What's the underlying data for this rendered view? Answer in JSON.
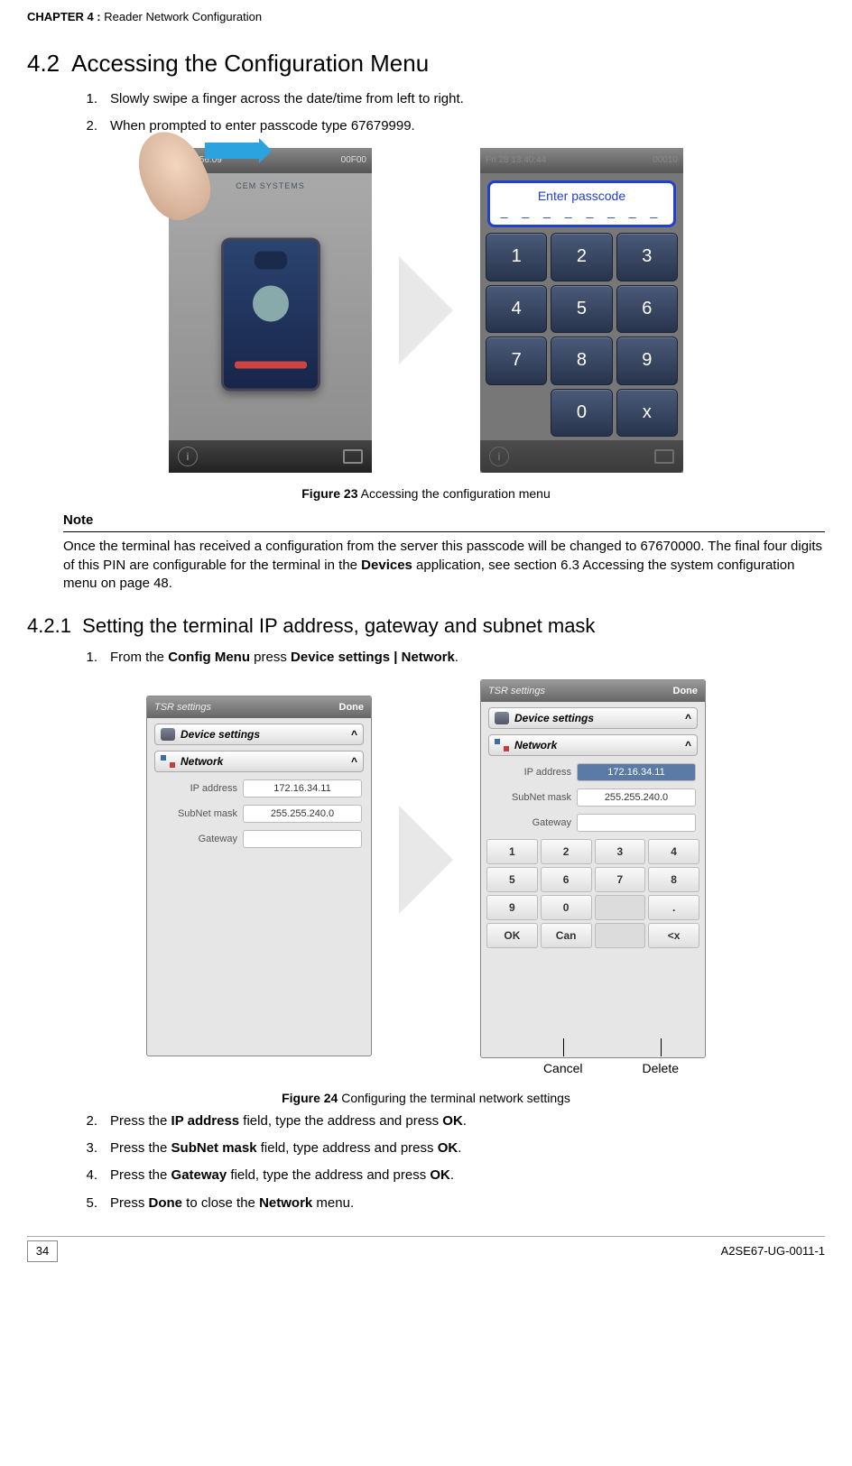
{
  "header": {
    "chapter": "CHAPTER 4 : ",
    "title": "Reader Network Configuration"
  },
  "section42": {
    "num": "4.2",
    "title": "Accessing the Configuration Menu",
    "steps": [
      {
        "n": "1.",
        "t": "Slowly swipe a finger across the date/time from left to right."
      },
      {
        "n": "2.",
        "t": "When prompted to enter passcode type 67679999."
      }
    ]
  },
  "fig23": {
    "label": "Figure 23",
    "caption": " Accessing the configuration menu",
    "left_status_time": "18  10:56:09",
    "left_status_code": "00F00",
    "left_brand": "CEM SYSTEMS",
    "right_status_time": "Fri 28  13:40:44",
    "right_status_code": "00010",
    "passcode_title": "Enter passcode",
    "passcode_dashes": "_ _ _ _ _ _ _ _",
    "keys": [
      "1",
      "2",
      "3",
      "4",
      "5",
      "6",
      "7",
      "8",
      "9",
      "",
      "0",
      "x"
    ]
  },
  "note": {
    "heading": "Note",
    "body_pre": "Once the terminal has received a configuration from the server this passcode will be changed to 67670000. The final four digits of this PIN are configurable for the terminal in the ",
    "body_bold": "Devices",
    "body_post": " application, see section 6.3   Accessing the system configuration menu on page 48."
  },
  "section421": {
    "num": "4.2.1",
    "title": "Setting the terminal IP address, gateway and subnet mask",
    "intro_n": "1.",
    "intro_pre": "From the ",
    "intro_b1": "Config Menu",
    "intro_mid": " press ",
    "intro_b2": "Device settings | Network",
    "intro_post": "."
  },
  "fig24": {
    "label": "Figure 24",
    "caption": " Configuring the terminal network settings",
    "hd_left": "TSR settings",
    "hd_done": "Done",
    "sec_device": "Device settings",
    "sec_network": "Network",
    "caret": "^",
    "row_ip_lbl": "IP address",
    "row_ip_val": "172.16.34.11",
    "row_sn_lbl": "SubNet mask",
    "row_sn_val": "255.255.240.0",
    "row_gw_lbl": "Gateway",
    "row_gw_val": "",
    "keys": [
      "1",
      "2",
      "3",
      "4",
      "5",
      "6",
      "7",
      "8",
      "9",
      "0",
      "",
      ".",
      "OK",
      "Can",
      "",
      "<x"
    ],
    "anno_cancel": "Cancel",
    "anno_delete": "Delete"
  },
  "steps_after": [
    {
      "n": "2.",
      "pre": "Press the ",
      "b1": "IP address",
      "mid": " field, type the address and press ",
      "b2": "OK",
      "post": "."
    },
    {
      "n": "3.",
      "pre": "Press the ",
      "b1": "SubNet mask",
      "mid": " field, type address and press ",
      "b2": "OK",
      "post": "."
    },
    {
      "n": "4.",
      "pre": "Press the ",
      "b1": "Gateway",
      "mid": " field, type the address and press ",
      "b2": "OK",
      "post": "."
    },
    {
      "n": "5.",
      "pre": "Press ",
      "b1": "Done",
      "mid": " to close the ",
      "b2": "Network",
      "post": " menu."
    }
  ],
  "footer": {
    "page": "34",
    "docid": "A2SE67-UG-0011-1"
  }
}
